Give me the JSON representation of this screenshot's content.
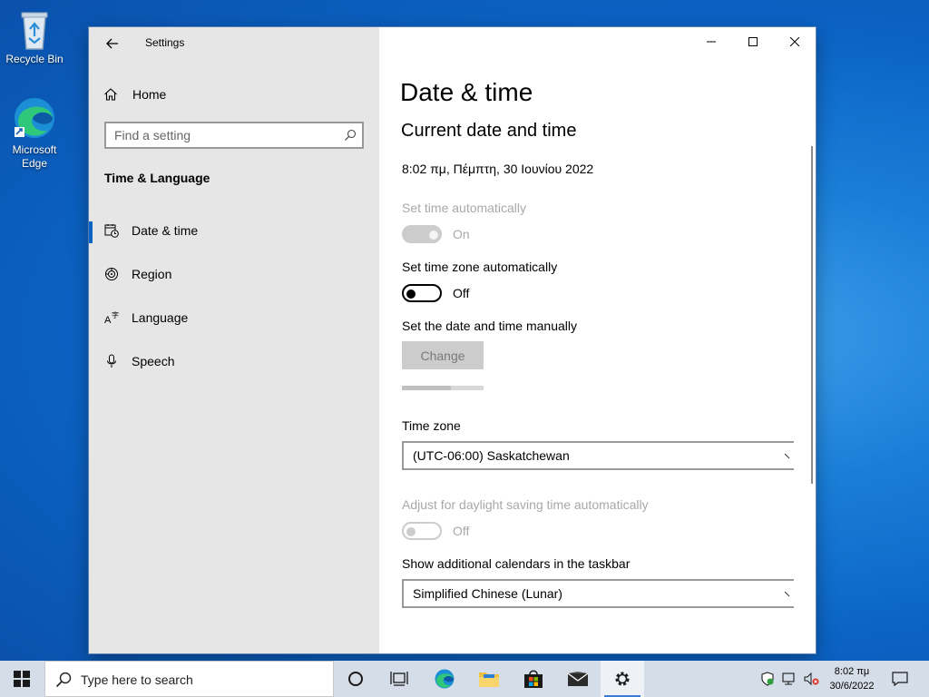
{
  "desktop": {
    "icons": [
      {
        "label": "Recycle Bin"
      },
      {
        "label": "Microsoft Edge"
      }
    ]
  },
  "window": {
    "title": "Settings",
    "nav": {
      "home_label": "Home",
      "search_placeholder": "Find a setting",
      "section_title": "Time & Language",
      "items": [
        {
          "label": "Date & time",
          "icon": "date-time-icon",
          "selected": true
        },
        {
          "label": "Region",
          "icon": "region-icon",
          "selected": false
        },
        {
          "label": "Language",
          "icon": "language-icon",
          "selected": false
        },
        {
          "label": "Speech",
          "icon": "microphone-icon",
          "selected": false
        }
      ]
    },
    "content": {
      "page_title": "Date & time",
      "section_title": "Current date and time",
      "current_datetime": "8:02 πμ, Πέμπτη, 30 Ιουνίου 2022",
      "set_time_auto": {
        "label": "Set time automatically",
        "state": "On",
        "on": true,
        "enabled": false
      },
      "set_timezone_auto": {
        "label": "Set time zone automatically",
        "state": "Off",
        "on": false,
        "enabled": true
      },
      "manual": {
        "label": "Set the date and time manually",
        "button": "Change",
        "enabled": false
      },
      "manual_progress": 0.6,
      "timezone": {
        "label": "Time zone",
        "value": "(UTC-06:00) Saskatchewan"
      },
      "dst": {
        "label": "Adjust for daylight saving time automatically",
        "state": "Off",
        "on": false,
        "enabled": false
      },
      "calendars": {
        "label": "Show additional calendars in the taskbar",
        "value": "Simplified Chinese (Lunar)"
      }
    }
  },
  "taskbar": {
    "search_placeholder": "Type here to search",
    "clock_time": "8:02 πμ",
    "clock_date": "30/6/2022"
  },
  "colors": {
    "accent": "#0a64c8",
    "nav_bg": "#e6e6e6",
    "disabled_text": "#a8a8a8"
  }
}
